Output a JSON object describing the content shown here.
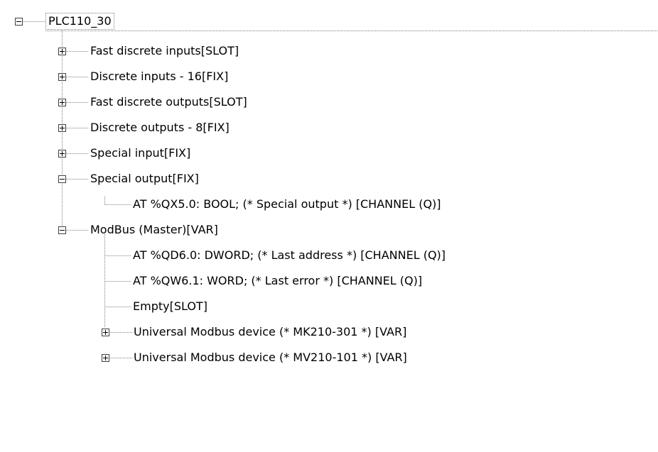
{
  "tree": {
    "root": {
      "label": "PLC110_30",
      "expanded": true
    },
    "items": [
      {
        "label": "Fast discrete inputs[SLOT]",
        "expanded": false
      },
      {
        "label": "Discrete inputs - 16[FIX]",
        "expanded": false
      },
      {
        "label": "Fast discrete outputs[SLOT]",
        "expanded": false
      },
      {
        "label": "Discrete outputs - 8[FIX]",
        "expanded": false
      },
      {
        "label": "Special input[FIX]",
        "expanded": false
      },
      {
        "label": "Special output[FIX]",
        "expanded": true
      },
      {
        "label": "AT %QX5.0: BOOL; (* Special output *) [CHANNEL (Q)]"
      },
      {
        "label": "ModBus (Master)[VAR]",
        "expanded": true
      },
      {
        "label": "AT %QD6.0: DWORD; (* Last address *) [CHANNEL (Q)]"
      },
      {
        "label": "AT %QW6.1: WORD; (* Last error *) [CHANNEL (Q)]"
      },
      {
        "label": "Empty[SLOT]"
      },
      {
        "label": "Universal Modbus device (* MK210-301 *) [VAR]",
        "expanded": false
      },
      {
        "label": "Universal Modbus device (* MV210-101 *) [VAR]",
        "expanded": false
      }
    ]
  }
}
